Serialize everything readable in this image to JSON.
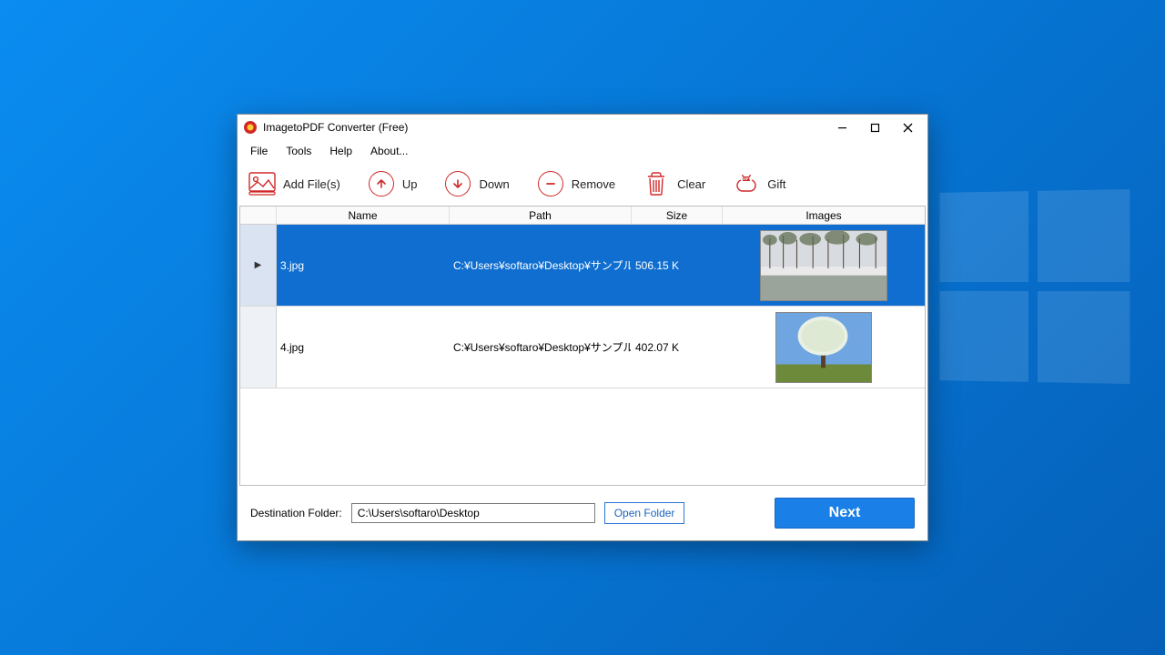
{
  "window": {
    "title": "ImagetoPDF Converter (Free)"
  },
  "menu": {
    "file": "File",
    "tools": "Tools",
    "help": "Help",
    "about": "About..."
  },
  "toolbar": {
    "add_files": "Add File(s)",
    "up": "Up",
    "down": "Down",
    "remove": "Remove",
    "clear": "Clear",
    "gift": "Gift"
  },
  "columns": {
    "name": "Name",
    "path": "Path",
    "size": "Size",
    "images": "Images"
  },
  "rows": [
    {
      "name": "3.jpg",
      "path": "C:¥Users¥softaro¥Desktop¥サンプル¥画...",
      "size": "506.15 K",
      "selected": true
    },
    {
      "name": "4.jpg",
      "path": "C:¥Users¥softaro¥Desktop¥サンプル¥画...",
      "size": "402.07 K",
      "selected": false
    }
  ],
  "footer": {
    "dest_label": "Destination Folder:",
    "dest_value": "C:\\Users\\softaro\\Desktop",
    "open_folder": "Open Folder",
    "next": "Next"
  }
}
